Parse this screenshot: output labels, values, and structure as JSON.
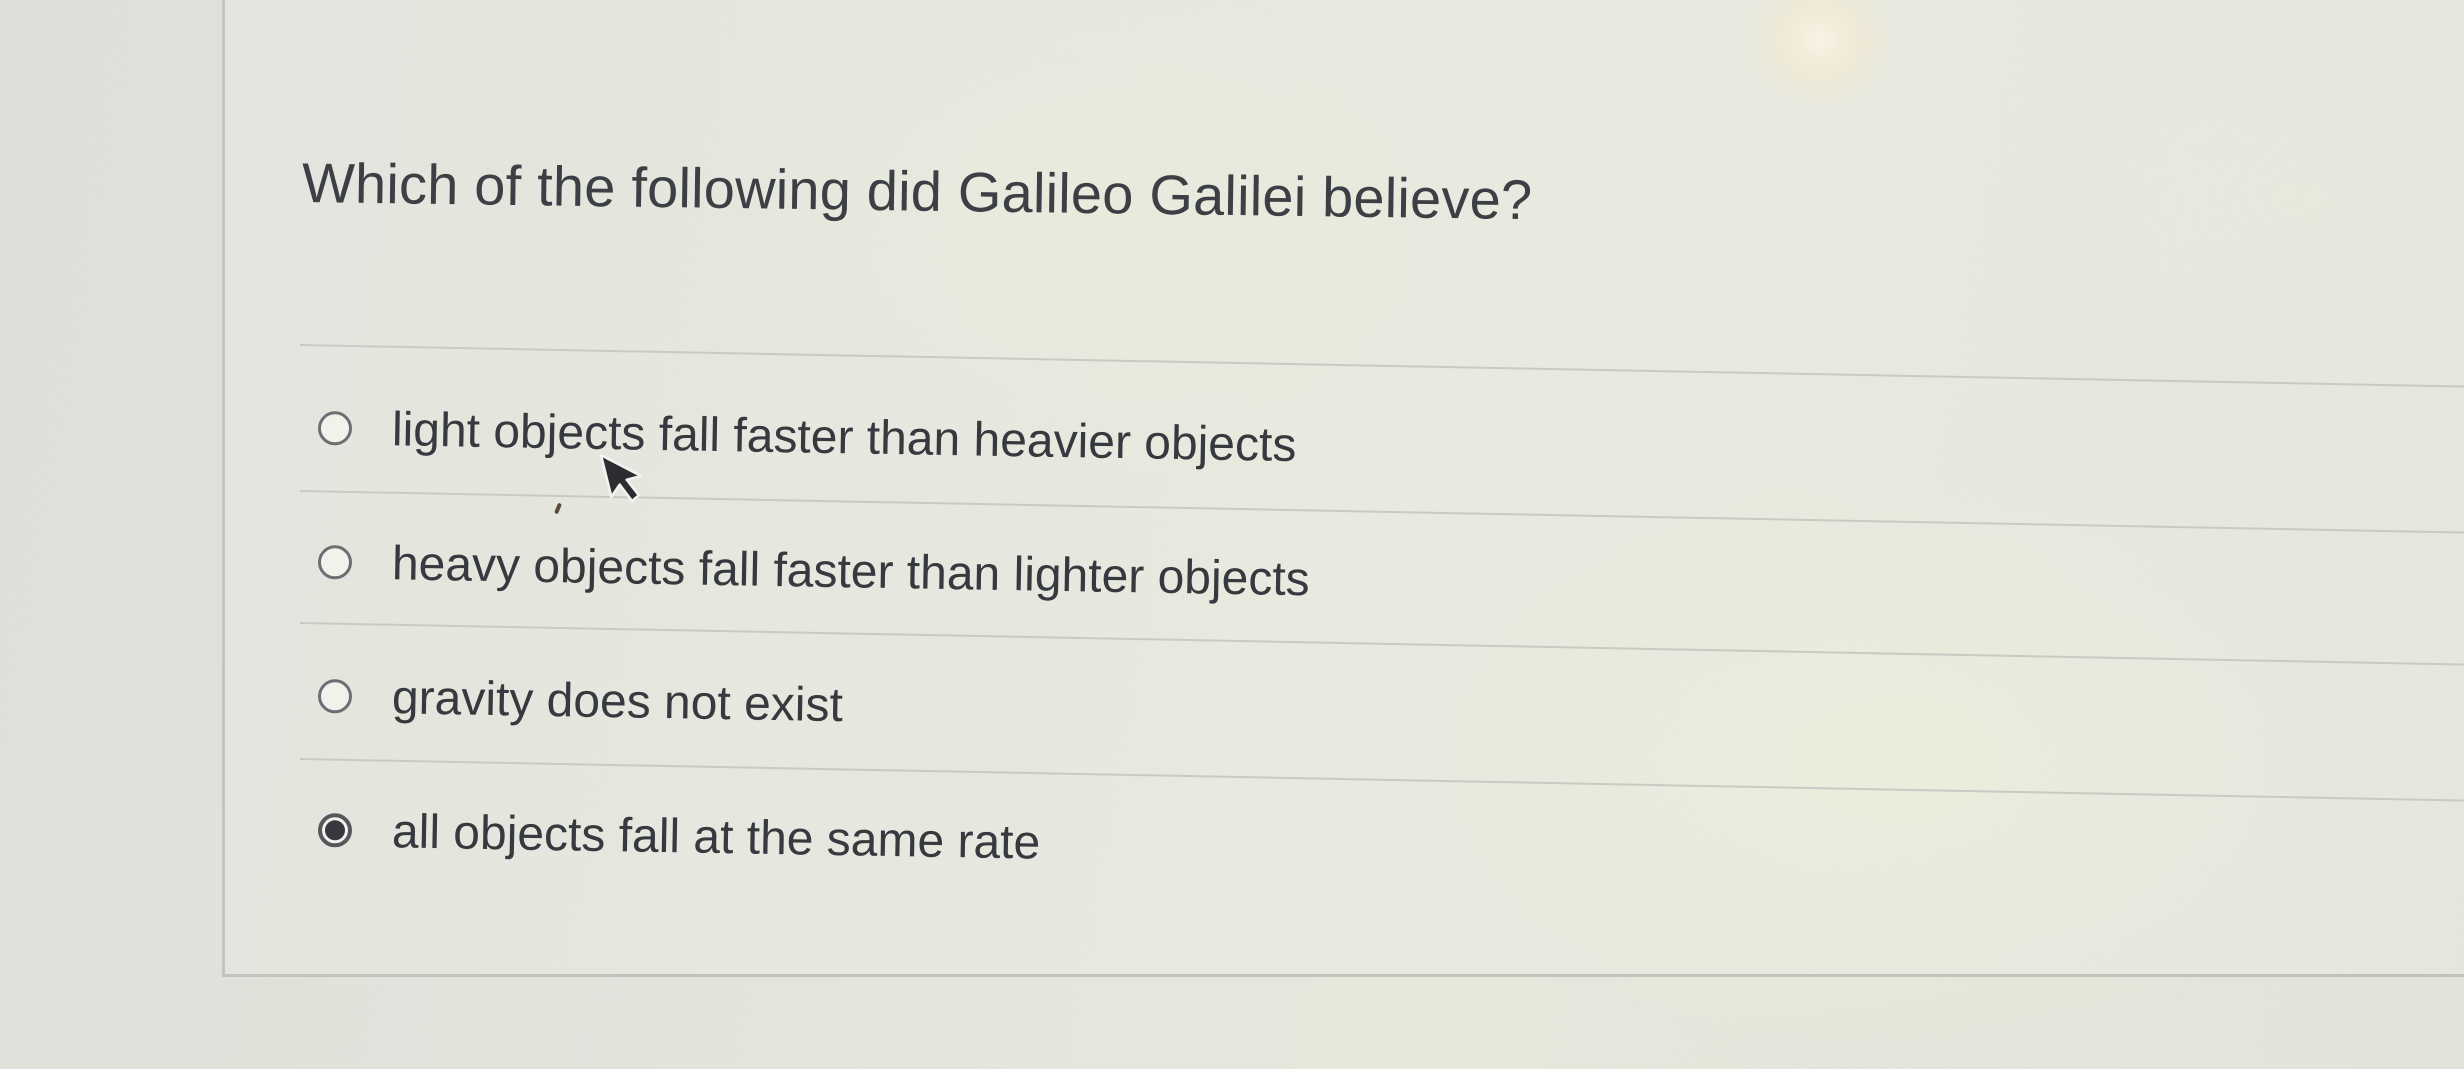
{
  "question": {
    "text": "Which of the following did Galileo Galilei believe?"
  },
  "answers": [
    {
      "label": "light objects fall faster than heavier objects",
      "selected": false
    },
    {
      "label": "heavy objects fall faster than lighter objects",
      "selected": false
    },
    {
      "label": "gravity does not exist",
      "selected": false
    },
    {
      "label": "all objects fall at the same rate",
      "selected": true
    }
  ],
  "icons": {
    "cursor": "arrow-cursor-icon",
    "radio_unselected": "radio-empty-icon",
    "radio_selected": "radio-filled-icon"
  },
  "colors": {
    "text": "#36393e",
    "radio_border": "#6b6e73",
    "radio_fill": "#36383d",
    "divider": "#c9cac4"
  }
}
